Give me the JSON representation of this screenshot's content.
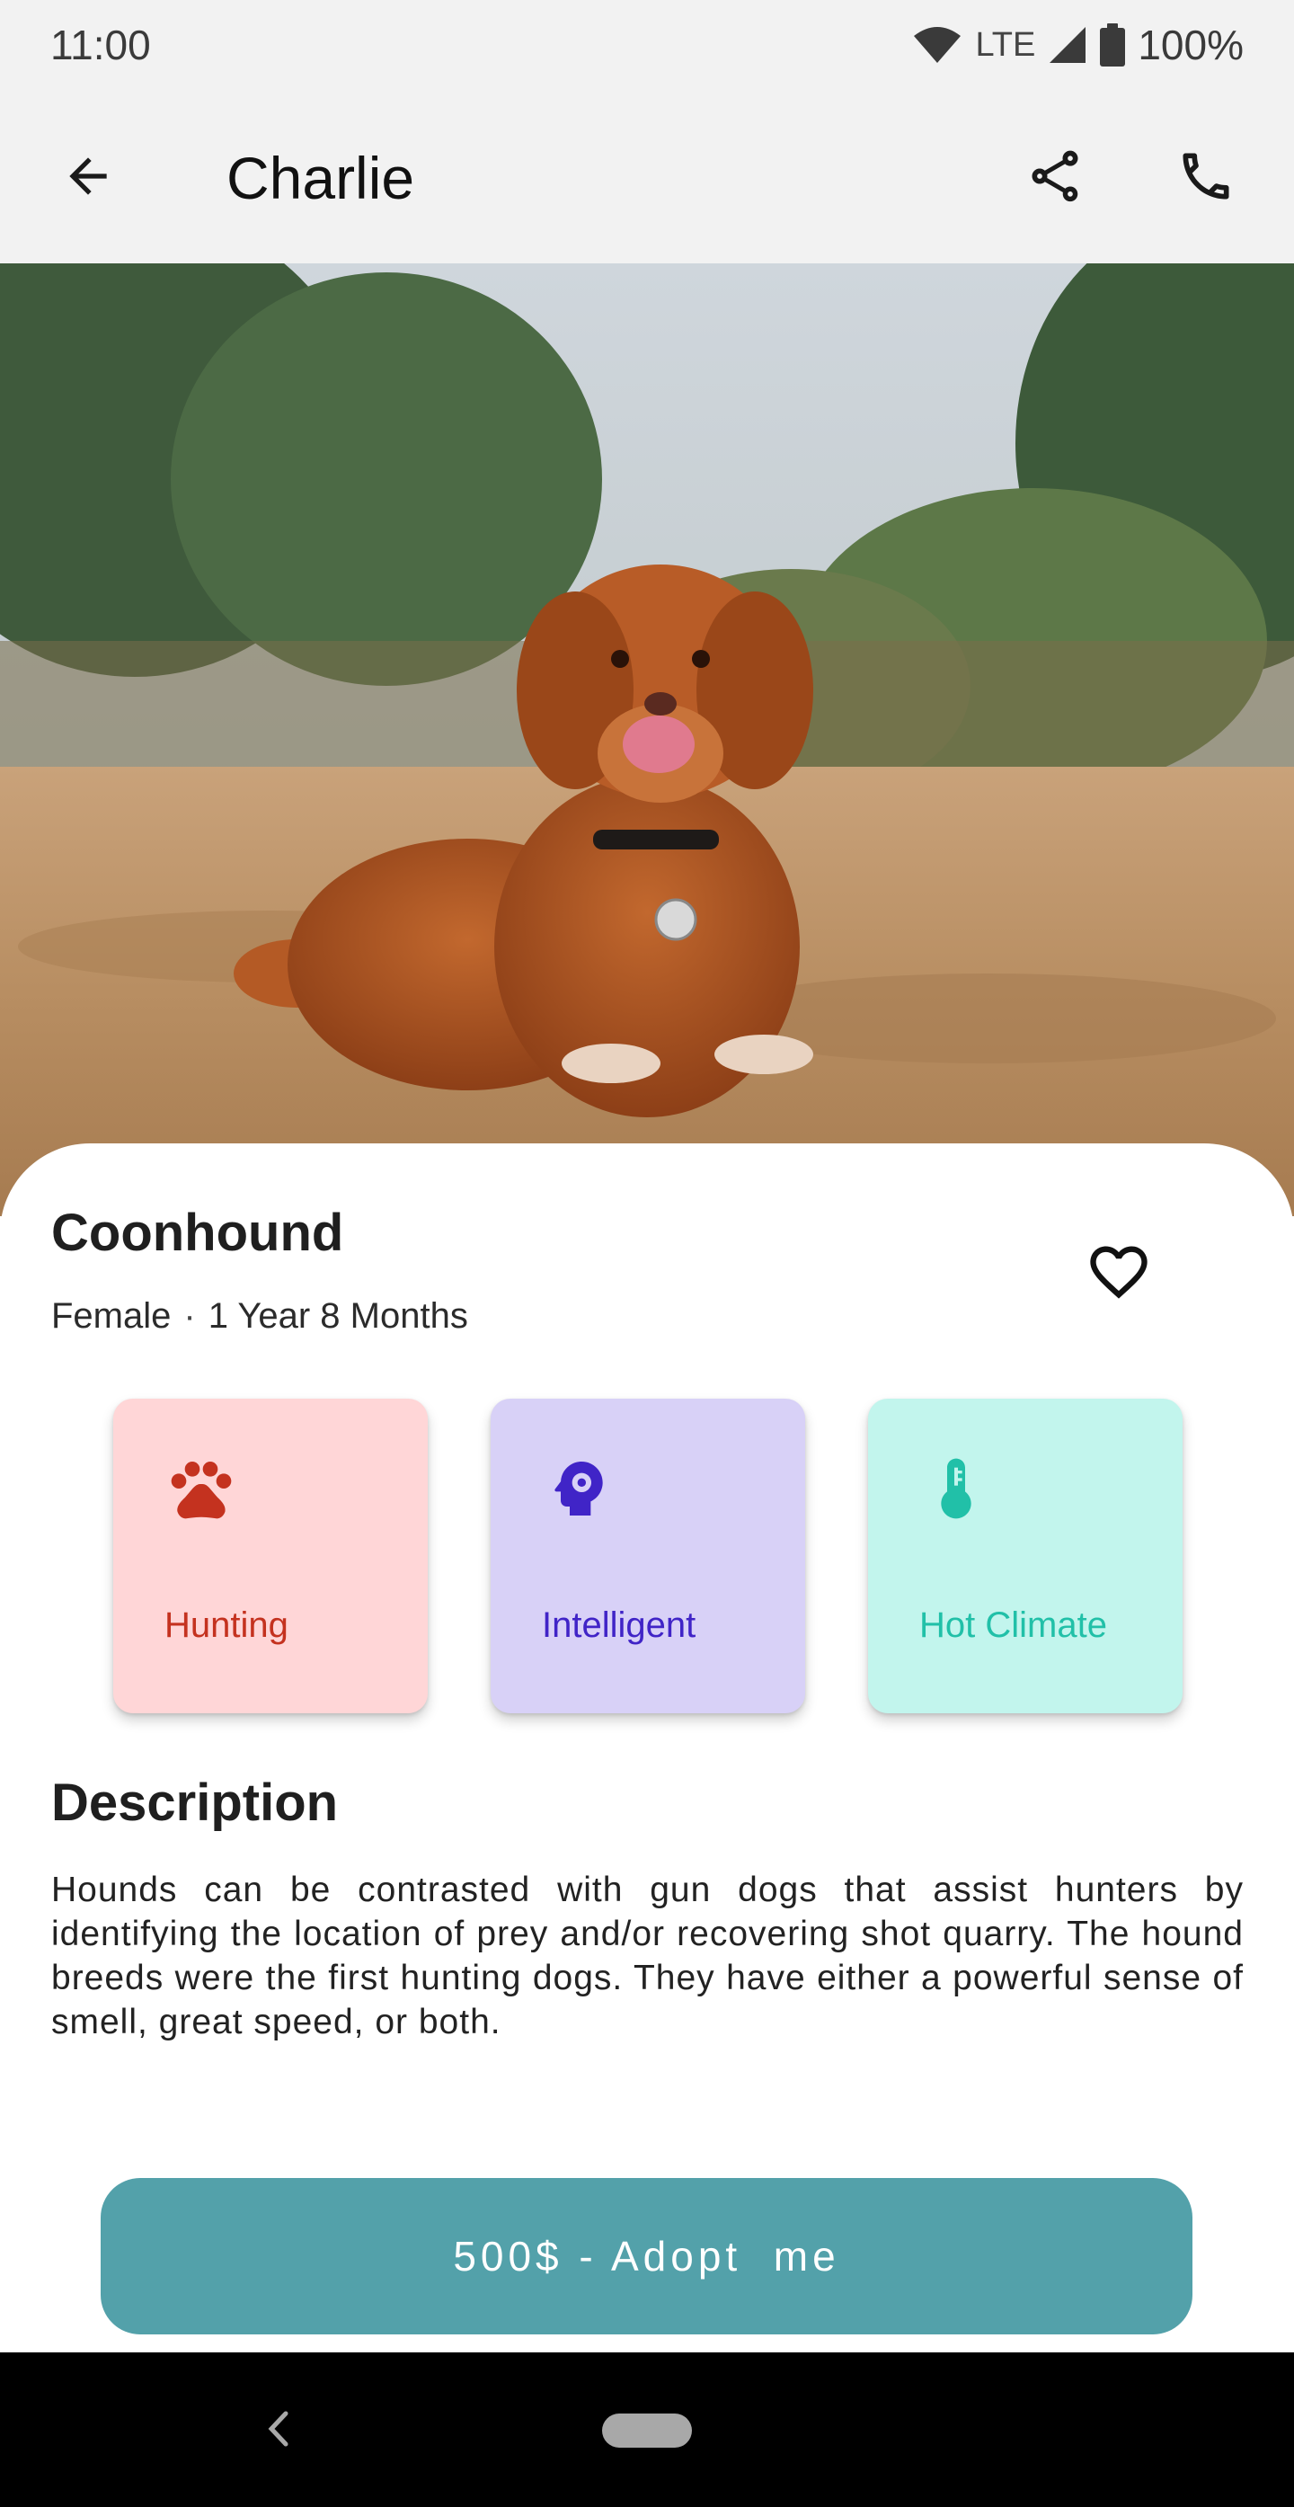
{
  "status_bar": {
    "time": "11:00",
    "network": "LTE",
    "battery": "100%",
    "icons": [
      "wifi-icon",
      "signal-icon",
      "battery-icon"
    ]
  },
  "app_bar": {
    "title": "Charlie",
    "back_icon": "arrow-back-icon",
    "share_icon": "share-icon",
    "call_icon": "phone-icon"
  },
  "pet": {
    "photo": "dog-photo",
    "breed": "Coonhound",
    "gender": "Female",
    "separator": "·",
    "age": "1 Year 8 Months",
    "favorite_icon": "heart-outline-icon"
  },
  "traits": [
    {
      "label": "Hunting",
      "icon": "paw-icon",
      "color": "#c4321f",
      "bg": "#ffd6d7"
    },
    {
      "label": "Intelligent",
      "icon": "brain-gear-icon",
      "color": "#4024c7",
      "bg": "#d8d1f7"
    },
    {
      "label": "Hot Climate",
      "icon": "thermometer-icon",
      "color": "#21c0a8",
      "bg": "#c2f5ed"
    }
  ],
  "description": {
    "title": "Description",
    "text": "Hounds can be contrasted with gun dogs that assist hunters by identifying the location of prey and/or recovering shot quarry. The hound breeds were the first hunting dogs. They have either a powerful sense of smell, great speed, or both."
  },
  "adopt_button": {
    "label": "500$ - Adopt  me",
    "color": "#53a1aa"
  },
  "nav_bar": {
    "back_icon": "nav-back-icon",
    "home_icon": "nav-home-pill"
  }
}
